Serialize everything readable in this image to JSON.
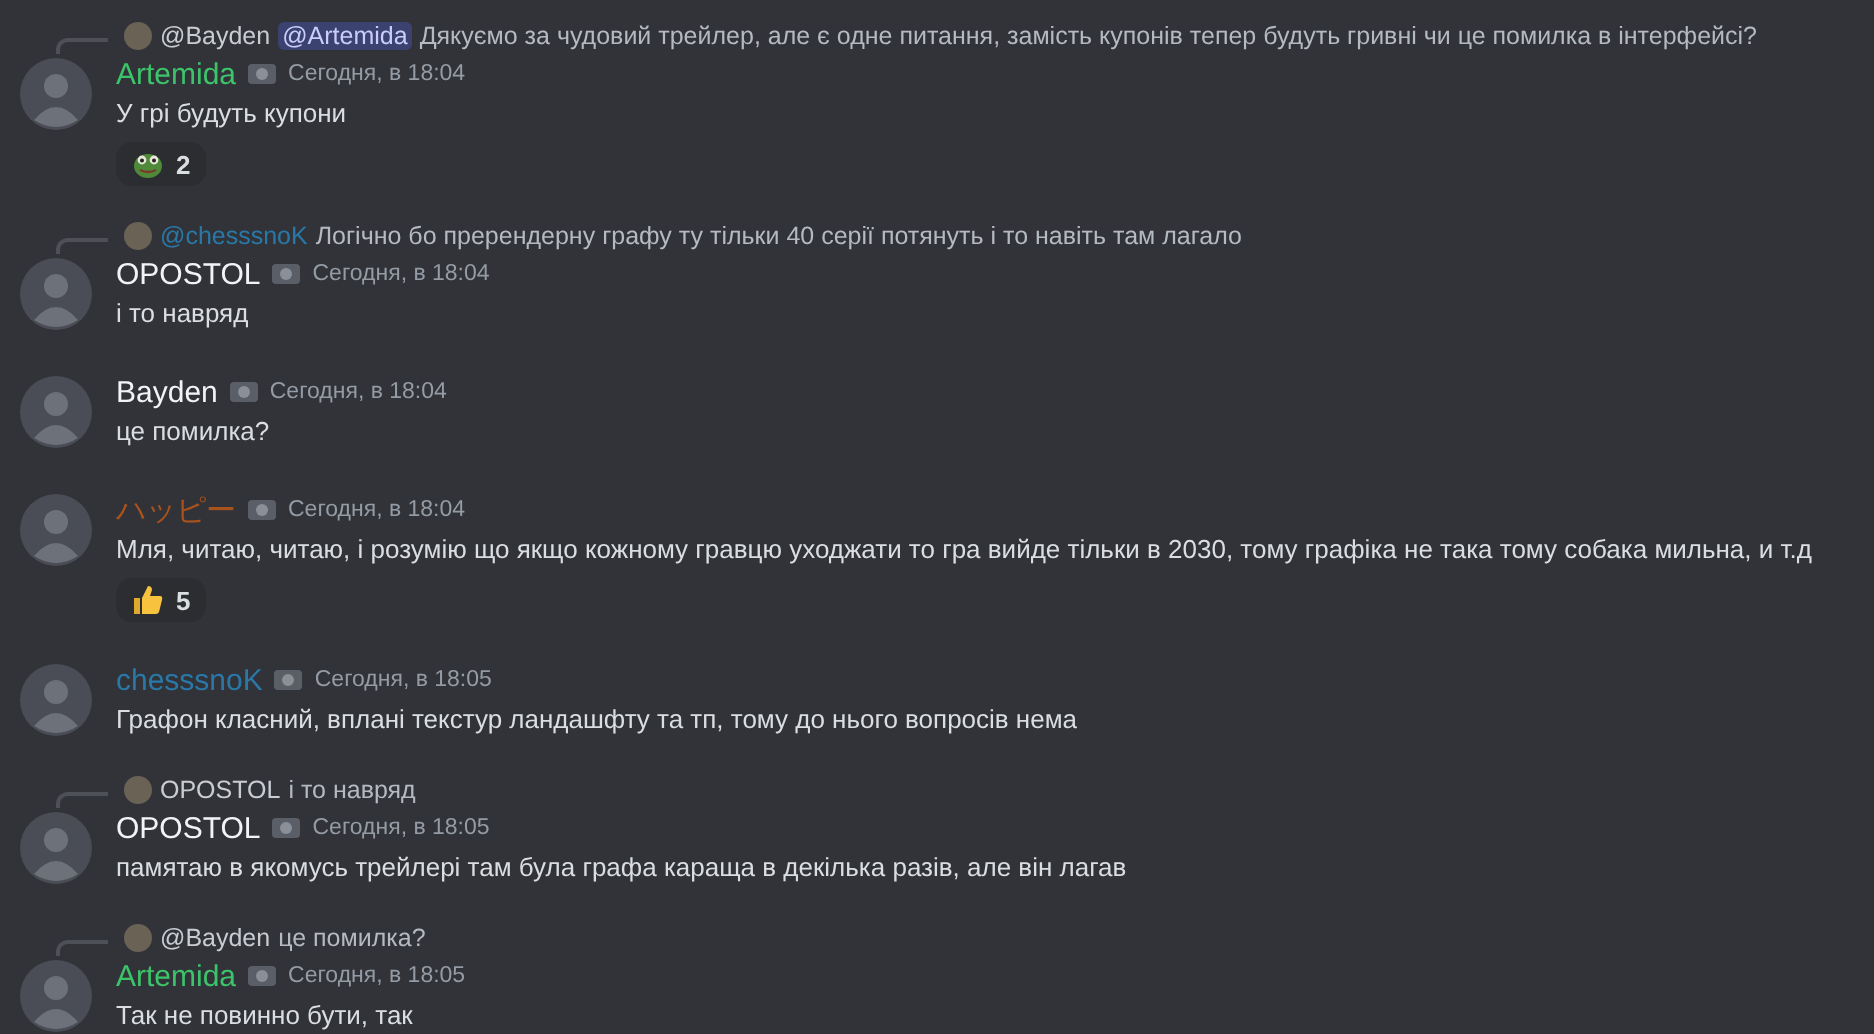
{
  "messages": [
    {
      "reply": {
        "author": "@Bayden",
        "color": "#c9cdd2",
        "mention": "@Artemida",
        "text": "Дякуємо за чудовий трейлер, але є одне питання, замість купонів тепер будуть гривні чи це помилка в інтерфейсі?"
      },
      "author": "Artemida",
      "color": "#3bc46a",
      "time": "Сегодня, в 18:04",
      "text": "У грі будуть купони",
      "reaction": {
        "kind": "frog",
        "count": "2"
      }
    },
    {
      "reply": {
        "author": "@chesssnoK",
        "color": "#2a78a8",
        "text": "Логічно бо пререндерну графу ту тільки 40 серії потянуть і то навіть там лагало"
      },
      "author": "OPOSTOL",
      "color": "#f2f3f5",
      "time": "Сегодня, в 18:04",
      "text": "і то навряд"
    },
    {
      "author": "Bayden",
      "color": "#f2f3f5",
      "time": "Сегодня, в 18:04",
      "text": "це помилка?"
    },
    {
      "author": "ハッピー",
      "color": "#a8521c",
      "time": "Сегодня, в 18:04",
      "text": "Мля, читаю, читаю, і розумію що якщо кожному гравцю уходжати то гра вийде тільки в 2030, тому графіка не така тому собака мильна, и т.д",
      "reaction": {
        "kind": "thumbs-up",
        "count": "5"
      }
    },
    {
      "author": "chesssnoK",
      "color": "#2a78a8",
      "time": "Сегодня, в 18:05",
      "text": "Графон класний, вплані текстур ландашфту та тп, тому до нього вопросів нема"
    },
    {
      "reply": {
        "author": "OPOSTOL",
        "color": "#c9cdd2",
        "text": "і то навряд"
      },
      "author": "OPOSTOL",
      "color": "#f2f3f5",
      "time": "Сегодня, в 18:05",
      "text": "памятаю в якомусь трейлері там була графа караща в декілька разів, але він лагав"
    },
    {
      "reply": {
        "author": "@Bayden",
        "color": "#c9cdd2",
        "text": "це помилка?"
      },
      "author": "Artemida",
      "color": "#3bc46a",
      "time": "Сегодня, в 18:05",
      "text": "Так не повинно бути, так"
    }
  ]
}
